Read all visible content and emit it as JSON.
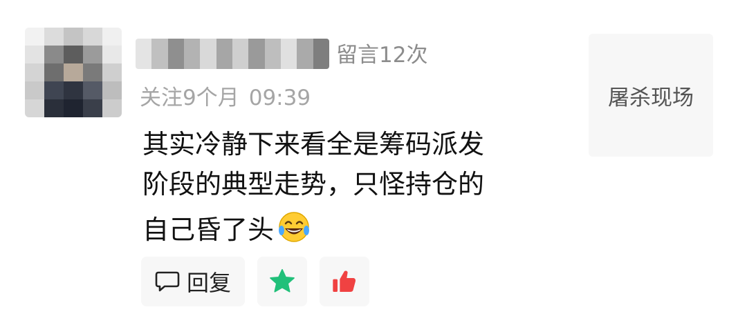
{
  "comment": {
    "message_count_text": "留言12次",
    "follow_duration": "关注9个月",
    "time": "09:39",
    "text_lines": [
      "其实冷静下来看全是筹码派发",
      "阶段的典型走势，只怪持仓的",
      "自己昏了头"
    ],
    "emoji_icon": "laughing-tears-emoji"
  },
  "actions": {
    "reply_label": "回复",
    "favorite_icon": "star-icon",
    "like_icon": "thumbs-up-icon",
    "favorite_color": "#21c07a",
    "like_color": "#f04242"
  },
  "side_card": {
    "label": "屠杀现场"
  }
}
